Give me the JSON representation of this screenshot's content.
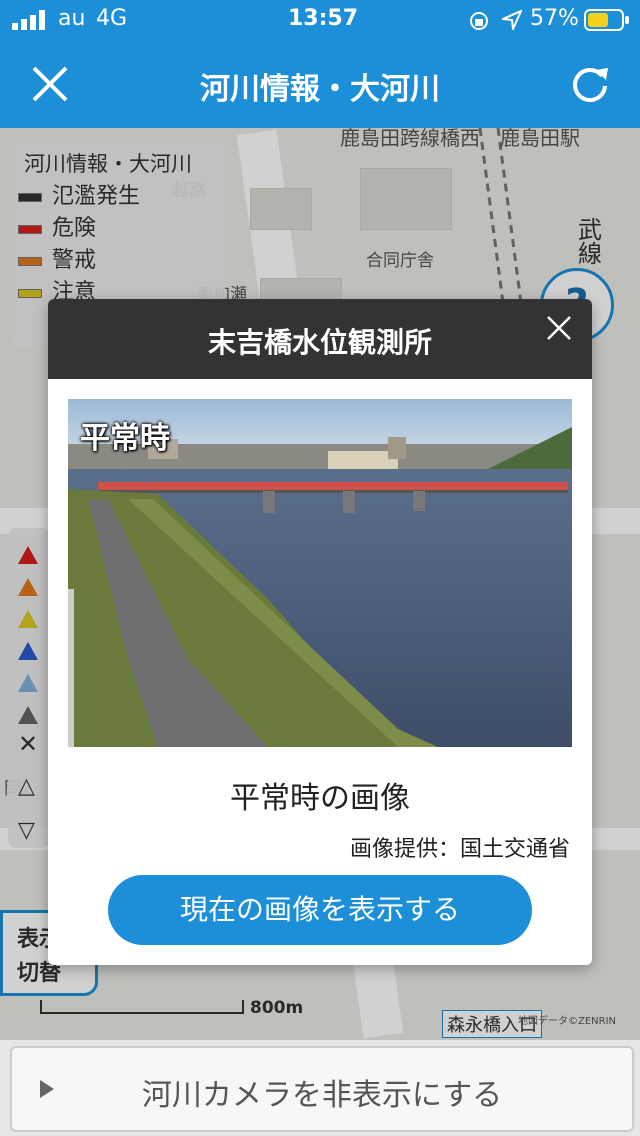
{
  "status_bar": {
    "carrier": "au",
    "network": "4G",
    "time": "13:57",
    "battery": "57%"
  },
  "nav": {
    "title": "河川情報・大河川",
    "close_icon": "close-icon",
    "refresh_icon": "refresh-icon"
  },
  "legend": {
    "title": "河川情報・大河川",
    "items": [
      {
        "label": "氾濫発生",
        "color": "#333333"
      },
      {
        "label": "危険",
        "color": "#d81e1e"
      },
      {
        "label": "警戒",
        "color": "#e0781e"
      },
      {
        "label": "注意",
        "color": "#d8c81e"
      }
    ]
  },
  "map": {
    "labels": {
      "top_line": "鹿島田跨線橋西",
      "top_line2": "鹿島田駅",
      "road1": "越路",
      "office": "合同庁舎",
      "district": "南加瀬",
      "line_right": "武",
      "line_right2": "線",
      "okaemachi": "岡2",
      "left_btn": "表示",
      "left_btn2": "切替",
      "scale": "800m",
      "station": "森永橋入口",
      "copyright": "地図データ©ZENRIN"
    },
    "help_label": "?"
  },
  "modal": {
    "title": "末吉橋水位観測所",
    "photo_tag": "平常時",
    "caption": "平常時の画像",
    "credit": "画像提供：国土交通省",
    "button": "現在の画像を表示する"
  },
  "bottom": {
    "label": "河川カメラを非表示にする"
  }
}
